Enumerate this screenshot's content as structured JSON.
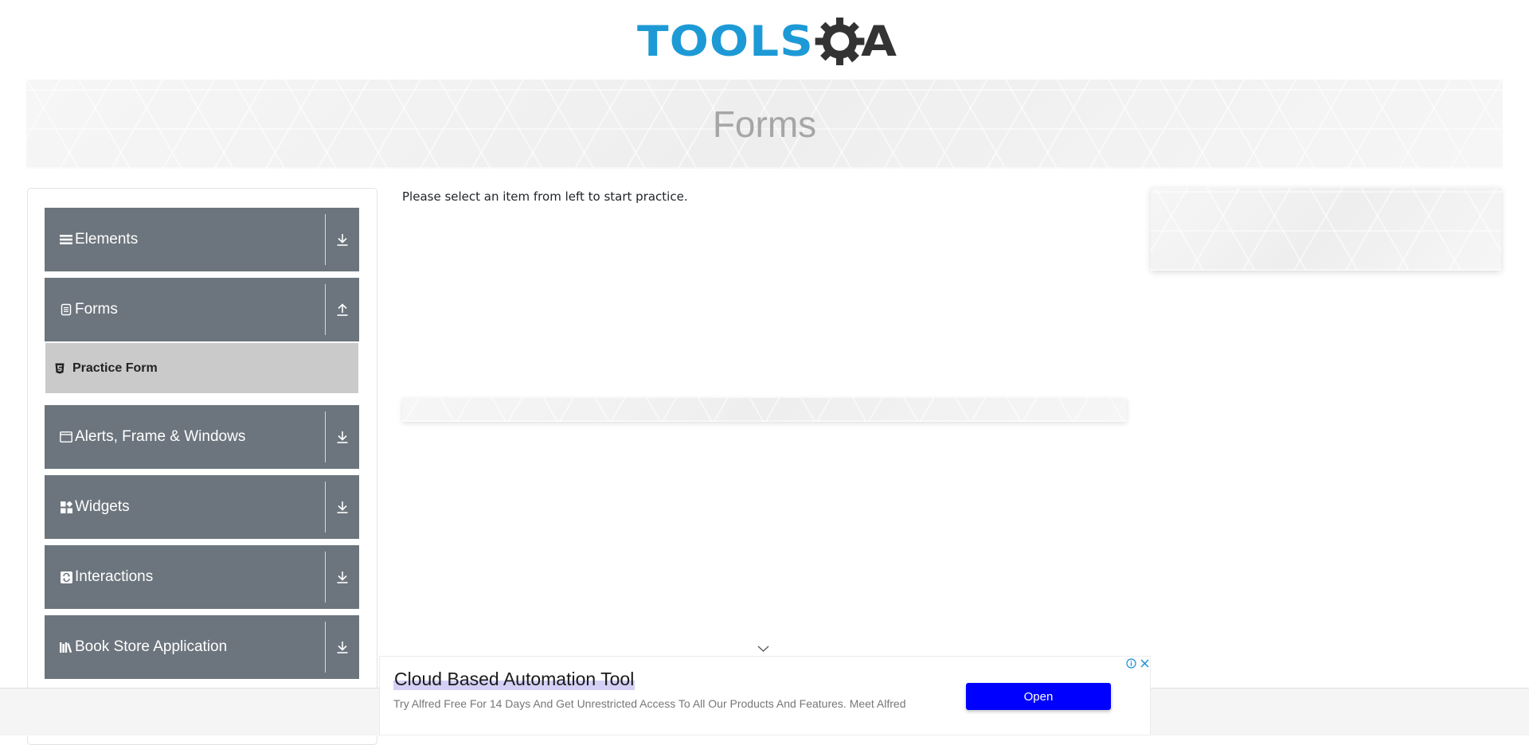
{
  "header": {
    "logo_text_primary": "TOOLS",
    "logo_text_secondary": "QA",
    "logo_colors": {
      "tools": "#1d9ad6",
      "qa": "#333333"
    }
  },
  "banner": {
    "title": "Forms"
  },
  "sidebar": {
    "groups": [
      {
        "label": "Elements",
        "icon": "list-icon",
        "toggle": "expand-icon",
        "expanded": false
      },
      {
        "label": "Forms",
        "icon": "document-icon",
        "toggle": "collapse-icon",
        "expanded": true
      },
      {
        "label": "Alerts, Frame & Windows",
        "icon": "window-icon",
        "toggle": "expand-icon",
        "expanded": false
      },
      {
        "label": "Widgets",
        "icon": "grid-icon",
        "toggle": "expand-icon",
        "expanded": false
      },
      {
        "label": "Interactions",
        "icon": "interaction-icon",
        "toggle": "expand-icon",
        "expanded": false
      },
      {
        "label": "Book Store Application",
        "icon": "books-icon",
        "toggle": "expand-icon",
        "expanded": false
      }
    ],
    "forms_items": [
      {
        "label": "Practice Form",
        "icon": "html5-icon"
      }
    ],
    "group_color": "#6c757d"
  },
  "main": {
    "instruction": "Please select an item from left to start practice."
  },
  "ad": {
    "title": "Cloud Based Automation Tool",
    "text": "Try Alfred Free For 14 Days And Get Unrestricted Access To All Our Products And Features. Meet Alfred",
    "button": "Open",
    "button_color": "#0000ff",
    "adchoices_icon": "info-icon",
    "close_icon": "close-icon"
  }
}
